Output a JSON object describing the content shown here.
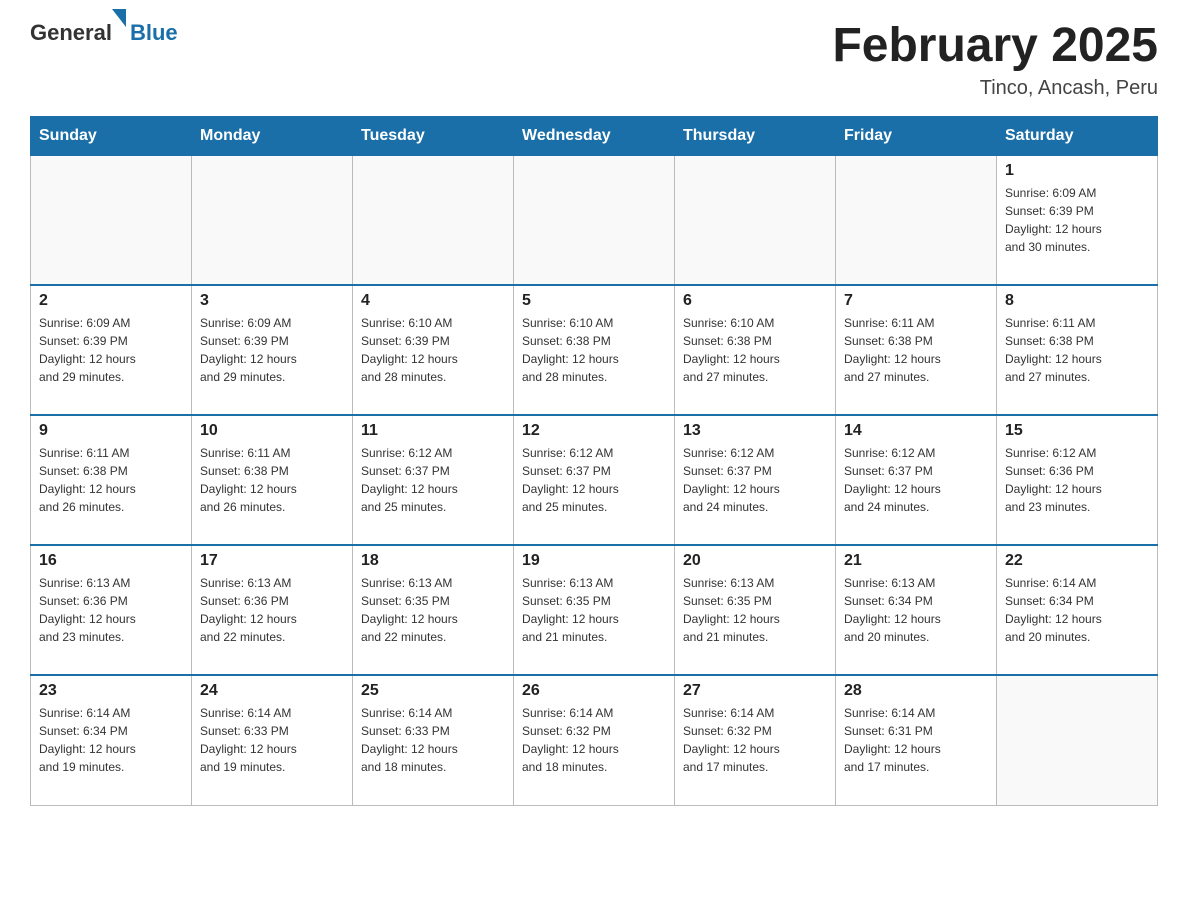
{
  "header": {
    "logo": {
      "general": "General",
      "blue": "Blue"
    },
    "title": "February 2025",
    "subtitle": "Tinco, Ancash, Peru"
  },
  "days_of_week": [
    "Sunday",
    "Monday",
    "Tuesday",
    "Wednesday",
    "Thursday",
    "Friday",
    "Saturday"
  ],
  "weeks": [
    [
      {
        "day": "",
        "info": ""
      },
      {
        "day": "",
        "info": ""
      },
      {
        "day": "",
        "info": ""
      },
      {
        "day": "",
        "info": ""
      },
      {
        "day": "",
        "info": ""
      },
      {
        "day": "",
        "info": ""
      },
      {
        "day": "1",
        "info": "Sunrise: 6:09 AM\nSunset: 6:39 PM\nDaylight: 12 hours\nand 30 minutes."
      }
    ],
    [
      {
        "day": "2",
        "info": "Sunrise: 6:09 AM\nSunset: 6:39 PM\nDaylight: 12 hours\nand 29 minutes."
      },
      {
        "day": "3",
        "info": "Sunrise: 6:09 AM\nSunset: 6:39 PM\nDaylight: 12 hours\nand 29 minutes."
      },
      {
        "day": "4",
        "info": "Sunrise: 6:10 AM\nSunset: 6:39 PM\nDaylight: 12 hours\nand 28 minutes."
      },
      {
        "day": "5",
        "info": "Sunrise: 6:10 AM\nSunset: 6:38 PM\nDaylight: 12 hours\nand 28 minutes."
      },
      {
        "day": "6",
        "info": "Sunrise: 6:10 AM\nSunset: 6:38 PM\nDaylight: 12 hours\nand 27 minutes."
      },
      {
        "day": "7",
        "info": "Sunrise: 6:11 AM\nSunset: 6:38 PM\nDaylight: 12 hours\nand 27 minutes."
      },
      {
        "day": "8",
        "info": "Sunrise: 6:11 AM\nSunset: 6:38 PM\nDaylight: 12 hours\nand 27 minutes."
      }
    ],
    [
      {
        "day": "9",
        "info": "Sunrise: 6:11 AM\nSunset: 6:38 PM\nDaylight: 12 hours\nand 26 minutes."
      },
      {
        "day": "10",
        "info": "Sunrise: 6:11 AM\nSunset: 6:38 PM\nDaylight: 12 hours\nand 26 minutes."
      },
      {
        "day": "11",
        "info": "Sunrise: 6:12 AM\nSunset: 6:37 PM\nDaylight: 12 hours\nand 25 minutes."
      },
      {
        "day": "12",
        "info": "Sunrise: 6:12 AM\nSunset: 6:37 PM\nDaylight: 12 hours\nand 25 minutes."
      },
      {
        "day": "13",
        "info": "Sunrise: 6:12 AM\nSunset: 6:37 PM\nDaylight: 12 hours\nand 24 minutes."
      },
      {
        "day": "14",
        "info": "Sunrise: 6:12 AM\nSunset: 6:37 PM\nDaylight: 12 hours\nand 24 minutes."
      },
      {
        "day": "15",
        "info": "Sunrise: 6:12 AM\nSunset: 6:36 PM\nDaylight: 12 hours\nand 23 minutes."
      }
    ],
    [
      {
        "day": "16",
        "info": "Sunrise: 6:13 AM\nSunset: 6:36 PM\nDaylight: 12 hours\nand 23 minutes."
      },
      {
        "day": "17",
        "info": "Sunrise: 6:13 AM\nSunset: 6:36 PM\nDaylight: 12 hours\nand 22 minutes."
      },
      {
        "day": "18",
        "info": "Sunrise: 6:13 AM\nSunset: 6:35 PM\nDaylight: 12 hours\nand 22 minutes."
      },
      {
        "day": "19",
        "info": "Sunrise: 6:13 AM\nSunset: 6:35 PM\nDaylight: 12 hours\nand 21 minutes."
      },
      {
        "day": "20",
        "info": "Sunrise: 6:13 AM\nSunset: 6:35 PM\nDaylight: 12 hours\nand 21 minutes."
      },
      {
        "day": "21",
        "info": "Sunrise: 6:13 AM\nSunset: 6:34 PM\nDaylight: 12 hours\nand 20 minutes."
      },
      {
        "day": "22",
        "info": "Sunrise: 6:14 AM\nSunset: 6:34 PM\nDaylight: 12 hours\nand 20 minutes."
      }
    ],
    [
      {
        "day": "23",
        "info": "Sunrise: 6:14 AM\nSunset: 6:34 PM\nDaylight: 12 hours\nand 19 minutes."
      },
      {
        "day": "24",
        "info": "Sunrise: 6:14 AM\nSunset: 6:33 PM\nDaylight: 12 hours\nand 19 minutes."
      },
      {
        "day": "25",
        "info": "Sunrise: 6:14 AM\nSunset: 6:33 PM\nDaylight: 12 hours\nand 18 minutes."
      },
      {
        "day": "26",
        "info": "Sunrise: 6:14 AM\nSunset: 6:32 PM\nDaylight: 12 hours\nand 18 minutes."
      },
      {
        "day": "27",
        "info": "Sunrise: 6:14 AM\nSunset: 6:32 PM\nDaylight: 12 hours\nand 17 minutes."
      },
      {
        "day": "28",
        "info": "Sunrise: 6:14 AM\nSunset: 6:31 PM\nDaylight: 12 hours\nand 17 minutes."
      },
      {
        "day": "",
        "info": ""
      }
    ]
  ]
}
